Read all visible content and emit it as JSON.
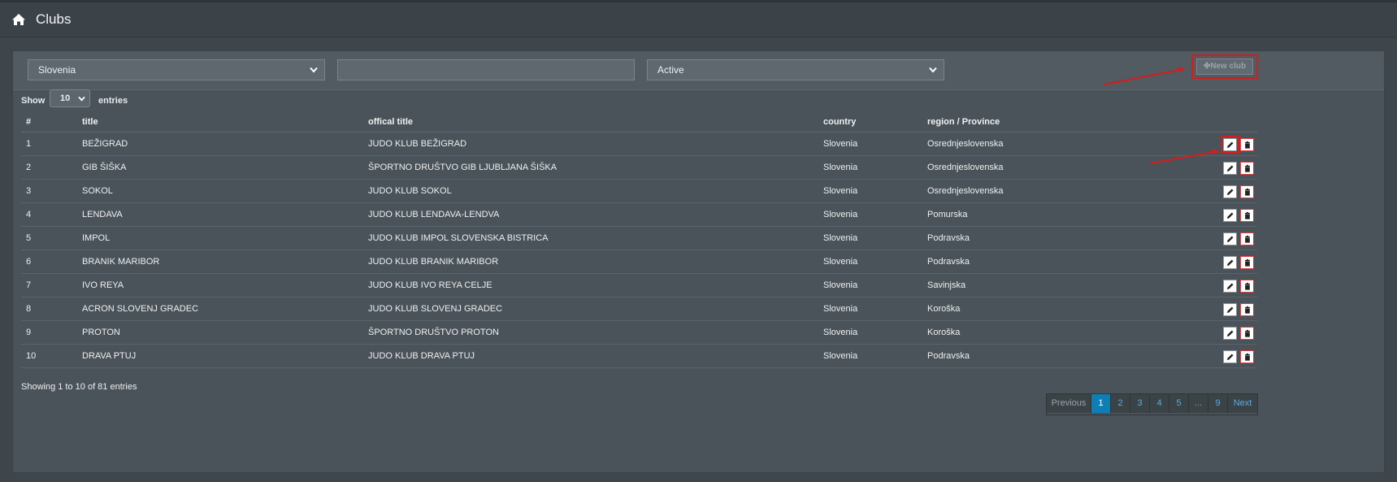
{
  "header": {
    "title": "Clubs",
    "home_icon": "home-icon"
  },
  "filters": {
    "country_value": "Slovenia",
    "search_value": "",
    "status_value": "Active",
    "new_club_label": "✤New club"
  },
  "show": {
    "prefix": "Show",
    "value": "10",
    "suffix": "entries"
  },
  "table": {
    "columns": [
      "#",
      "title",
      "offical title",
      "country",
      "region / Province"
    ],
    "rows": [
      [
        "1",
        "BEŽIGRAD",
        "JUDO KLUB BEŽIGRAD",
        "Slovenia",
        "Osrednjeslovenska"
      ],
      [
        "2",
        "GIB ŠIŠKA",
        "ŠPORTNO DRUŠTVO GIB LJUBLJANA ŠIŠKA",
        "Slovenia",
        "Osrednjeslovenska"
      ],
      [
        "3",
        "SOKOL",
        "JUDO KLUB SOKOL",
        "Slovenia",
        "Osrednjeslovenska"
      ],
      [
        "4",
        "LENDAVA",
        "JUDO KLUB LENDAVA-LENDVA",
        "Slovenia",
        "Pomurska"
      ],
      [
        "5",
        "IMPOL",
        "JUDO KLUB IMPOL SLOVENSKA BISTRICA",
        "Slovenia",
        "Podravska"
      ],
      [
        "6",
        "BRANIK MARIBOR",
        "JUDO KLUB BRANIK MARIBOR",
        "Slovenia",
        "Podravska"
      ],
      [
        "7",
        "IVO REYA",
        "JUDO KLUB IVO REYA CELJE",
        "Slovenia",
        "Savinjska"
      ],
      [
        "8",
        "ACRON SLOVENJ GRADEC",
        "JUDO KLUB SLOVENJ GRADEC",
        "Slovenia",
        "Koroška"
      ],
      [
        "9",
        "PROTON",
        "ŠPORTNO DRUŠTVO PROTON",
        "Slovenia",
        "Koroška"
      ],
      [
        "10",
        "DRAVA PTUJ",
        "JUDO KLUB DRAVA PTUJ",
        "Slovenia",
        "Podravska"
      ]
    ]
  },
  "footer": {
    "info": "Showing 1 to 10 of 81 entries"
  },
  "pagination": {
    "previous": "Previous",
    "pages": [
      "1",
      "2",
      "3",
      "4",
      "5",
      "...",
      "9"
    ],
    "next": "Next",
    "active": "1"
  },
  "colors": {
    "accent": "#0e7fb5",
    "highlight": "#d81b1b",
    "link": "#5aaee0"
  }
}
